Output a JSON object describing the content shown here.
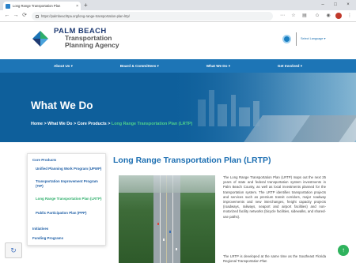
{
  "browser": {
    "tab_title": "Long Range Transportation Plan",
    "tab_close": "×",
    "new_tab": "+",
    "url": "https://palmbeachtpa.org/long-range-transportation-plan-lrtp/",
    "window_controls": [
      "–",
      "□",
      "×"
    ],
    "nav": {
      "back": "←",
      "forward": "→",
      "reload": "⟳"
    }
  },
  "header": {
    "brand_line1": "PALM BEACH",
    "brand_line2": "Transportation",
    "brand_line3": "Planning Agency",
    "select_language": "Select Language",
    "colors": {
      "brand_blue": "#1f3b73",
      "logo_green": "#2eae6b",
      "logo_blue": "#1d75b6"
    }
  },
  "nav": {
    "items": [
      {
        "label": "About Us ▾"
      },
      {
        "label": "Board & Committees ▾"
      },
      {
        "label": "What We Do ▾"
      },
      {
        "label": "Get Involved ▾"
      }
    ],
    "color": "#1d75b6"
  },
  "hero": {
    "title": "What We Do",
    "breadcrumb_prefix": "Home > What We Do > Core Products > ",
    "breadcrumb_current": "Long Range Transportation Plan (LRTP)"
  },
  "sidebar": {
    "items": [
      {
        "label": "Core Products",
        "type": "head"
      },
      {
        "label": "Unified Planning Work Program (UPWP)",
        "type": "sub"
      },
      {
        "label": "Transportation Improvement Program (TIP)",
        "type": "sub"
      },
      {
        "label": "Long Range Transportation Plan (LRTP)",
        "type": "sub-active"
      },
      {
        "label": "Public Participation Plan (PPP)",
        "type": "sub"
      },
      {
        "label": "Initiatives",
        "type": "head"
      },
      {
        "label": "Funding Programs",
        "type": "head"
      }
    ]
  },
  "main": {
    "title": "Long Range Transportation Plan (LRTP)",
    "paragraphs": [
      "The Long Range Transportation Plan (LRTP) maps out the next 25 years of state and federal transportation system investments in Palm Beach County, as well as local investments planned for the transportation system. The LRTP identifies transportation projects and services such as premium transit corridors, major roadway improvements and new interchanges, freight capacity projects (roadways, railways, seaport and airport facilities) and non-motorized facility networks (bicycle facilities, sidewalks, and shared-use paths).",
      "The LRTP is developed at the same time as the Southeast Florida Regional Transportation Plan"
    ]
  },
  "widgets": {
    "recaptcha": "↻",
    "fab": "↑"
  }
}
